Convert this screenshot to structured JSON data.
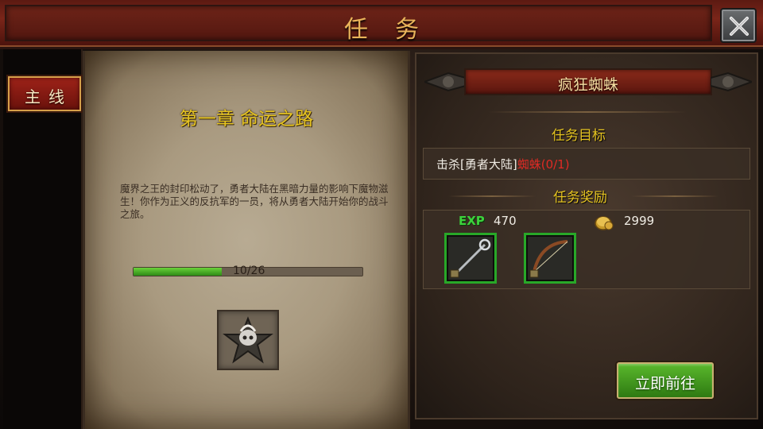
{
  "header": {
    "title": "任务"
  },
  "sidebar": {
    "tab_main": "主线"
  },
  "chapter": {
    "title": "第一章  命运之路",
    "story": "魔界之王的封印松动了，勇者大陆在黑暗力量的影响下魔物滋生！你作为正义的反抗军的一员，将从勇者大陆开始你的战斗之旅。",
    "progress_text": "10/26",
    "progress_value": 0.3846,
    "badge_icon": "star-skull-emblem-icon"
  },
  "quest": {
    "name": "疯狂蜘蛛",
    "objective_label": "任务目标",
    "objective_prefix": "击杀[勇者大陆]",
    "objective_target": "蜘蛛(0/1)",
    "reward_label": "任务奖励",
    "exp_label": "EXP",
    "exp_value": "470",
    "gold_value": "2999",
    "rewards": [
      {
        "icon": "staff-icon"
      },
      {
        "icon": "bow-icon"
      }
    ],
    "go_button": "立即前往"
  },
  "colors": {
    "accent_gold": "#e6c421",
    "objective_red": "#e02a24",
    "exp_green": "#3cd23c",
    "button_green": "#4aa822"
  }
}
